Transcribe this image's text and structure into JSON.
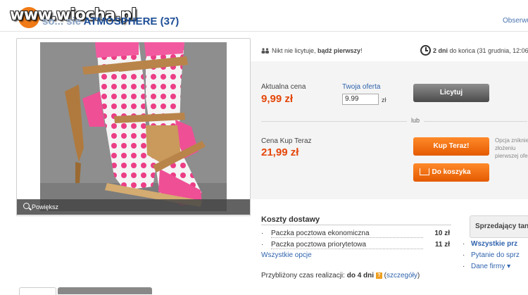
{
  "watermark": "www.wiocha.pl",
  "header": {
    "title_faded": "so...",
    "title_prefix": "sie",
    "title_main": "ATMOSPHERE (37)",
    "observe": "Obserwuj"
  },
  "gallery": {
    "zoom_label": "Powiększ"
  },
  "bidding": {
    "no_bids": "Nikt nie licytuje,",
    "be_first": "bądź pierwszy",
    "be_first_suffix": "!",
    "days_left": "2 dni",
    "end_text": "do końca (31 grudnia, 12:06"
  },
  "auction": {
    "current_label": "Aktualna cena",
    "current_price": "9,99 zł",
    "offer_label": "Twoja oferta",
    "offer_value": "9.99",
    "offer_unit": "zł",
    "bid_button": "Licytuj",
    "or_label": "lub"
  },
  "buynow": {
    "label": "Cena Kup Teraz",
    "price": "21,99 zł",
    "buy_button": "Kup Teraz!",
    "cart_button": "Do koszyka",
    "note": "Opcja zniknie po złożeniu pierwszej oferty."
  },
  "shipping": {
    "title": "Koszty dostawy",
    "rows": [
      {
        "name": "Paczka pocztowa ekonomiczna",
        "price": "10 zł"
      },
      {
        "name": "Paczka pocztowa priorytetowa",
        "price": "11 zł"
      }
    ],
    "all_options": "Wszystkie opcje",
    "realization_label": "Przybliżony czas realizacji:",
    "realization_value": "do 4 dni",
    "details_link": "szczegóły"
  },
  "seller": {
    "label": "Sprzedający tan",
    "links": [
      "Wszystkie prz",
      "Pytanie do sprz",
      "Dane firmy"
    ]
  },
  "colors": {
    "accent_orange": "#e45a00",
    "price": "#e5470b",
    "link": "#2f63ad",
    "title": "#1c4e96"
  }
}
